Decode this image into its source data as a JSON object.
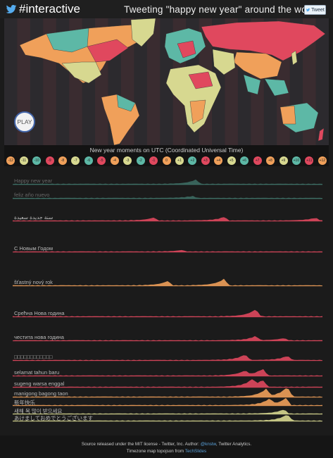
{
  "header": {
    "brand": "#interactive",
    "title": "Tweeting \"happy new year\" around the world",
    "tweet_button": "Tweet"
  },
  "map": {
    "play_label": "PLAY",
    "palette": [
      "#e0485e",
      "#5db8a6",
      "#f0a05a",
      "#d7d890",
      "#3f4046"
    ]
  },
  "timeline": {
    "label": "New year moments on UTC (Coordinated Universal Time)",
    "timezones": [
      {
        "label": "-12",
        "color": "#f0a05a"
      },
      {
        "label": "-11",
        "color": "#d7d890"
      },
      {
        "label": "-10",
        "color": "#5db8a6"
      },
      {
        "label": "-9",
        "color": "#e0485e"
      },
      {
        "label": "-8",
        "color": "#f0a05a"
      },
      {
        "label": "-7",
        "color": "#d7d890"
      },
      {
        "label": "-6",
        "color": "#5db8a6"
      },
      {
        "label": "-5",
        "color": "#e0485e"
      },
      {
        "label": "-4",
        "color": "#f0a05a"
      },
      {
        "label": "-3",
        "color": "#d7d890"
      },
      {
        "label": "-2",
        "color": "#5db8a6"
      },
      {
        "label": "-1",
        "color": "#e0485e"
      },
      {
        "label": "0",
        "color": "#f0a05a"
      },
      {
        "label": "+1",
        "color": "#d7d890"
      },
      {
        "label": "+2",
        "color": "#5db8a6"
      },
      {
        "label": "+3",
        "color": "#e0485e"
      },
      {
        "label": "+4",
        "color": "#f0a05a"
      },
      {
        "label": "+5",
        "color": "#d7d890"
      },
      {
        "label": "+6",
        "color": "#5db8a6"
      },
      {
        "label": "+7",
        "color": "#e0485e"
      },
      {
        "label": "+8",
        "color": "#f0a05a"
      },
      {
        "label": "+9",
        "color": "#d7d890"
      },
      {
        "label": "+10",
        "color": "#5db8a6"
      },
      {
        "label": "+11",
        "color": "#e0485e"
      },
      {
        "label": "+12",
        "color": "#f0a05a"
      }
    ]
  },
  "rows": [
    {
      "label": "Happy new year",
      "color": "#5db8a6"
    },
    {
      "label": "feliz año nuevo",
      "color": "#5db8a6"
    },
    {
      "label": "سنة جديدة سعيدة",
      "color": "#e0485e"
    },
    {
      "label": "С Новым Годом",
      "color": "#e0485e"
    },
    {
      "label": "šťastný nový rok",
      "color": "#f0a05a"
    },
    {
      "label": "Срећна Нова година",
      "color": "#e0485e"
    },
    {
      "label": "честита нова година",
      "color": "#e0485e"
    },
    {
      "label": "□□□□□□□□□□□□",
      "color": "#e0485e"
    },
    {
      "label": "selamat tahun baru",
      "color": "#e0485e"
    },
    {
      "label": "sugeng warsa enggal",
      "color": "#e0485e"
    },
    {
      "label": "manigong bagong taon",
      "color": "#f0a05a"
    },
    {
      "label": "新年快乐",
      "color": "#f0a05a"
    },
    {
      "label": "새해 복 많이 받으세요",
      "color": "#d7d890"
    },
    {
      "label": "あけましておめでとうございます",
      "color": "#d7d890"
    }
  ],
  "footer": {
    "line1_pre": "Source released under the MIT license - Twitter, Inc. Author: ",
    "author_link": "@knstw",
    "line1_post": ", Twitter Analytics.",
    "line2_pre": "Timezone map topojson from ",
    "techslides_link": "TechSlides"
  }
}
